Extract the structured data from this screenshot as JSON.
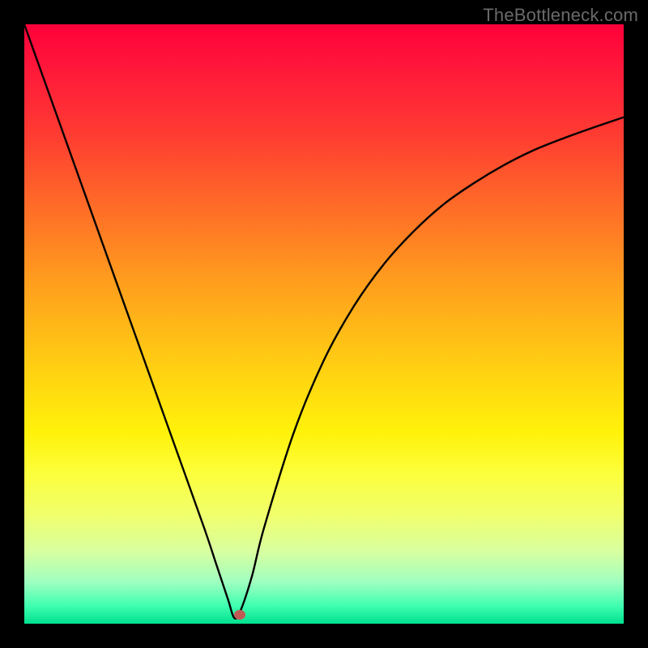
{
  "watermark": "TheBottleneck.com",
  "colors": {
    "frame": "#000000",
    "gradient_top": "#ff003a",
    "gradient_bottom": "#00e090",
    "curve": "#000000",
    "marker": "#c15a55"
  },
  "chart_data": {
    "type": "line",
    "title": "",
    "xlabel": "",
    "ylabel": "",
    "xlim": [
      0,
      100
    ],
    "ylim": [
      0,
      100
    ],
    "notch_x": 35,
    "marker": {
      "x": 36,
      "y": 1.5
    },
    "series": [
      {
        "name": "bottleneck-curve",
        "x": [
          0,
          5,
          10,
          15,
          20,
          25,
          30,
          32,
          34,
          35,
          36,
          38,
          40,
          45,
          50,
          55,
          60,
          65,
          70,
          75,
          80,
          85,
          90,
          95,
          100
        ],
        "y": [
          100,
          86,
          72,
          58,
          44,
          30,
          16,
          10,
          4,
          1,
          2,
          8,
          16,
          32,
          44,
          53,
          60,
          65.5,
          70,
          73.5,
          76.5,
          79,
          81,
          82.8,
          84.5
        ]
      }
    ]
  }
}
